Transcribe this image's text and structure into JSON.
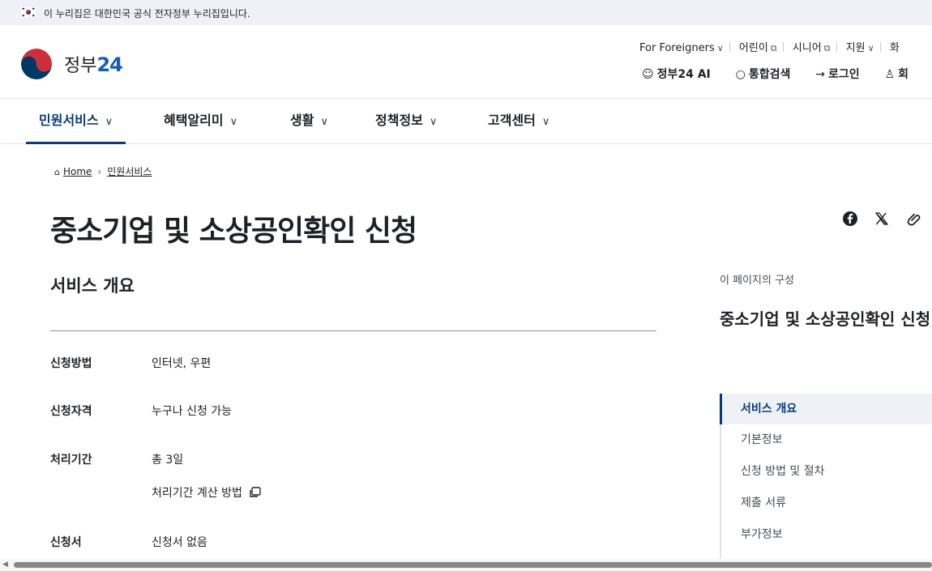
{
  "gov_banner": {
    "text": "이 누리집은 대한민국 공식 전자정부 누리집입니다.",
    "flag_icon": "korea-flag-icon"
  },
  "header": {
    "logo_text_prefix": "정부",
    "logo_text_num": "24",
    "util_links": [
      {
        "label": "For Foreigners",
        "icon": "chevron-down-icon"
      },
      {
        "label": "어린이",
        "icon": "external-link-icon"
      },
      {
        "label": "시니어",
        "icon": "external-link-icon"
      },
      {
        "label": "지원",
        "icon": "chevron-down-icon"
      },
      {
        "label": "화"
      }
    ],
    "actions": [
      {
        "label": "정부24 AI",
        "icon": "ai-robot-icon"
      },
      {
        "label": "통합검색",
        "icon": "search-icon"
      },
      {
        "label": "로그인",
        "icon": "login-icon"
      },
      {
        "label": "회",
        "icon": "user-plus-icon"
      }
    ]
  },
  "gnb": {
    "items": [
      {
        "label": "민원서비스",
        "active": true
      },
      {
        "label": "혜택알리미"
      },
      {
        "label": "생활"
      },
      {
        "label": "정책정보"
      },
      {
        "label": "고객센터"
      }
    ]
  },
  "breadcrumb": {
    "home": "Home",
    "current": "민원서비스"
  },
  "page": {
    "title": "중소기업 및 소상공인확인 신청",
    "share_icons": [
      "facebook-icon",
      "x-twitter-icon",
      "link-icon"
    ]
  },
  "overview": {
    "title": "서비스 개요",
    "rows": [
      {
        "label": "신청방법",
        "value": "인터넷, 우편"
      },
      {
        "label": "신청자격",
        "value": "누구나 신청 가능"
      },
      {
        "label": "처리기간",
        "value": "총 3일",
        "sub": "처리기간 계산 방법"
      },
      {
        "label": "신청서",
        "value": "신청서 없음"
      }
    ]
  },
  "toc": {
    "caption": "이 페이지의 구성",
    "title": "중소기업 및 소상공인확인 신청",
    "items": [
      "서비스 개요",
      "기본정보",
      "신청 방법 및 절차",
      "제출 서류",
      "부가정보"
    ]
  },
  "colors": {
    "accent": "#0b3a77",
    "brand_blue": "#135db5",
    "brand_red": "#cd2e3a"
  }
}
